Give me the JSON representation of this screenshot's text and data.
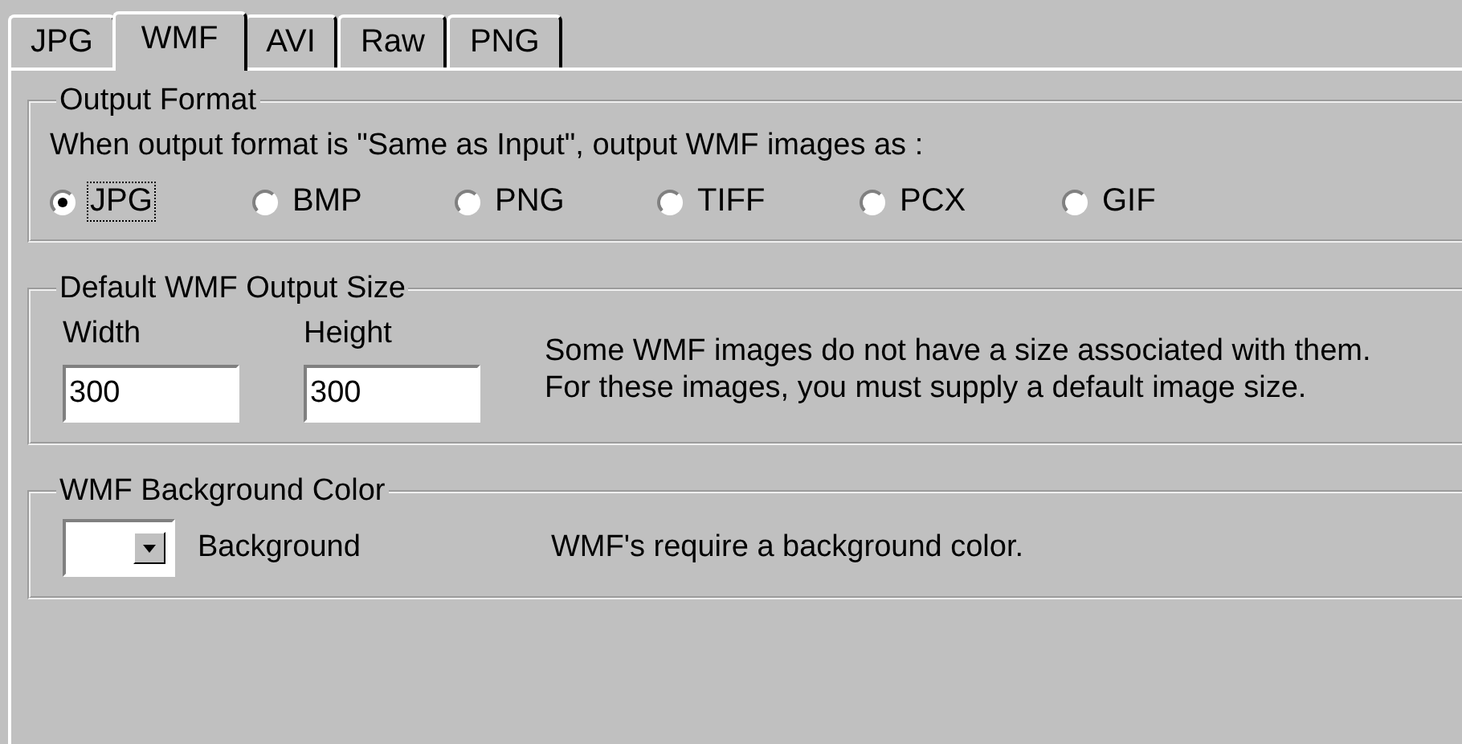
{
  "tabs": [
    {
      "label": "JPG",
      "selected": false
    },
    {
      "label": "WMF",
      "selected": true
    },
    {
      "label": "AVI",
      "selected": false
    },
    {
      "label": "Raw",
      "selected": false
    },
    {
      "label": "PNG",
      "selected": false
    }
  ],
  "output_format": {
    "title": "Output Format",
    "prompt": "When output format is \"Same as Input\", output WMF images as :",
    "options": [
      {
        "label": "JPG",
        "selected": true
      },
      {
        "label": "BMP",
        "selected": false
      },
      {
        "label": "PNG",
        "selected": false
      },
      {
        "label": "TIFF",
        "selected": false
      },
      {
        "label": "PCX",
        "selected": false
      },
      {
        "label": "GIF",
        "selected": false
      }
    ]
  },
  "output_size": {
    "title": "Default WMF Output Size",
    "fields": [
      {
        "label": "Width",
        "value": "300"
      },
      {
        "label": "Height",
        "value": "300"
      }
    ],
    "note": "Some WMF images do not have a size associated with them. For these images, you must supply a default image size."
  },
  "background_color": {
    "title": "WMF Background Color",
    "color": "#ffffff",
    "label": "Background",
    "note": "WMF's require a background color."
  }
}
